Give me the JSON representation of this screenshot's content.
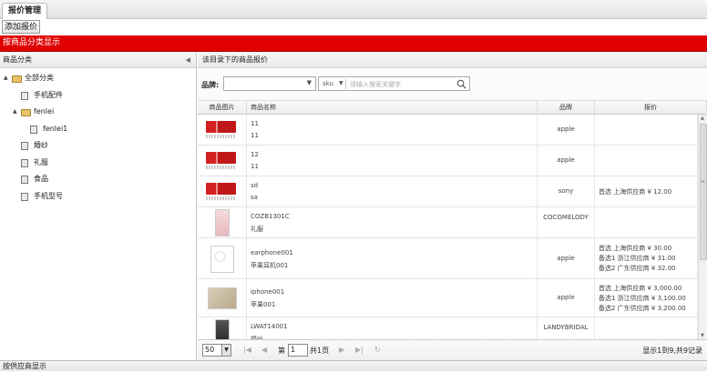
{
  "tab": {
    "label": "报价管理"
  },
  "toolbar": {
    "add_label": "添加报价"
  },
  "category_bar": {
    "label": "按商品分类显示"
  },
  "sidebar": {
    "title": "商品分类",
    "tree": [
      {
        "label": "全部分类",
        "level": 0,
        "type": "folder-open",
        "toggle": "▲"
      },
      {
        "label": "手机配件",
        "level": 1,
        "type": "file"
      },
      {
        "label": "fenlei",
        "level": 1,
        "type": "folder-open",
        "toggle": "▲"
      },
      {
        "label": "fenlei1",
        "level": 2,
        "type": "file"
      },
      {
        "label": "婚纱",
        "level": 1,
        "type": "file"
      },
      {
        "label": "礼服",
        "level": 1,
        "type": "file"
      },
      {
        "label": "食品",
        "level": 1,
        "type": "file"
      },
      {
        "label": "手机型号",
        "level": 1,
        "type": "file"
      }
    ]
  },
  "main": {
    "title": "该目录下的商品报价",
    "filter": {
      "brand_label": "品牌:",
      "brand_value": "",
      "sku_option": "sku",
      "search_placeholder": "请输入搜索关键字"
    },
    "columns": [
      "商品图片",
      "商品名称",
      "品牌",
      "报价"
    ],
    "rows": [
      {
        "image": "logo",
        "name1": "11",
        "name2": "11",
        "brand": "apple",
        "prices": []
      },
      {
        "image": "logo",
        "name1": "12",
        "name2": "11",
        "brand": "apple",
        "prices": []
      },
      {
        "image": "logo",
        "name1": "sd",
        "name2": "sa",
        "brand": "sony",
        "prices": [
          "首选 上海供应商 ¥ 12.00"
        ]
      },
      {
        "image": "dress",
        "name1": "COZB1301C",
        "name2": "礼服",
        "brand": "COCOMELODY",
        "prices": []
      },
      {
        "image": "earphone",
        "name1": "earphone001",
        "name2": "苹果耳机001",
        "brand": "apple",
        "prices": [
          "首选 上海供应商 ¥ 30.00",
          "备选1 浙江供应商 ¥ 31.00",
          "备选2 广东供应商 ¥ 32.00"
        ]
      },
      {
        "image": "phone",
        "name1": "iphone001",
        "name2": "苹果001",
        "brand": "apple",
        "prices": [
          "首选 上海供应商 ¥ 3,000.00",
          "备选1 浙江供应商 ¥ 3,100.00",
          "备选2 广东供应商 ¥ 3,200.00"
        ]
      },
      {
        "image": "dress2",
        "name1": "LWAT14001",
        "name2": "婚纱",
        "brand": "LANDYBRIDAL",
        "prices": []
      }
    ],
    "pager": {
      "page_size": "50",
      "page_prefix": "第",
      "page_value": "1",
      "page_suffix": "共1页",
      "info": "显示1到9,共9记录"
    }
  },
  "bottom_bar": {
    "label": "按供应商显示"
  },
  "colors": {
    "accent_red": "#e00000"
  }
}
